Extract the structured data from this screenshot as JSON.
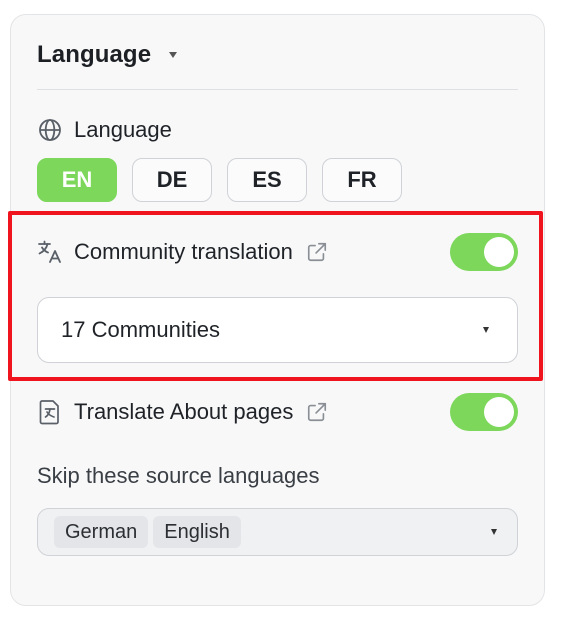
{
  "header": {
    "title": "Language"
  },
  "language_section": {
    "label": "Language",
    "buttons": [
      "EN",
      "DE",
      "ES",
      "FR"
    ],
    "active": "EN"
  },
  "community_translation": {
    "label": "Community translation",
    "enabled": true,
    "select_value": "17 Communities"
  },
  "translate_about": {
    "label": "Translate About pages",
    "enabled": true
  },
  "skip_languages": {
    "label": "Skip these source languages",
    "chips": [
      "German",
      "English"
    ]
  },
  "colors": {
    "accent_green": "#7cd75b",
    "highlight_red": "#f0141e"
  },
  "icons": {
    "globe": "globe-icon",
    "translate": "translate-icon",
    "external_link": "external-link-icon",
    "document_translate": "document-translate-icon",
    "dropdown": "chevron-down-icon"
  }
}
